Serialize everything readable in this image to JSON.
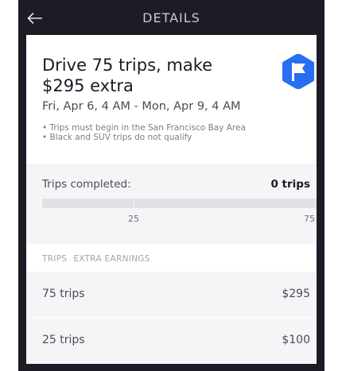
{
  "header": {
    "title": "DETAILS",
    "back_icon": "arrow-left-icon"
  },
  "promotion": {
    "title": "Drive 75 trips, make $295 extra",
    "badge_icon": "flag-icon",
    "badge_color": "#276ef1",
    "dates": "Fri, Apr 6, 4 AM - Mon, Apr 9, 4 AM",
    "rules": [
      "• Trips must begin in the San Francisco Bay Area",
      "• Black and SUV trips do not qualify"
    ]
  },
  "progress": {
    "label": "Trips completed:",
    "value_text": "0 trips",
    "completed": 0,
    "max": 75,
    "milestones": [
      "25",
      "75"
    ]
  },
  "tiers": {
    "columns": [
      "TRIPS",
      "EXTRA EARNINGS"
    ],
    "rows": [
      {
        "trips": "75 trips",
        "amount": "$295"
      },
      {
        "trips": "25 trips",
        "amount": "$100"
      }
    ]
  }
}
